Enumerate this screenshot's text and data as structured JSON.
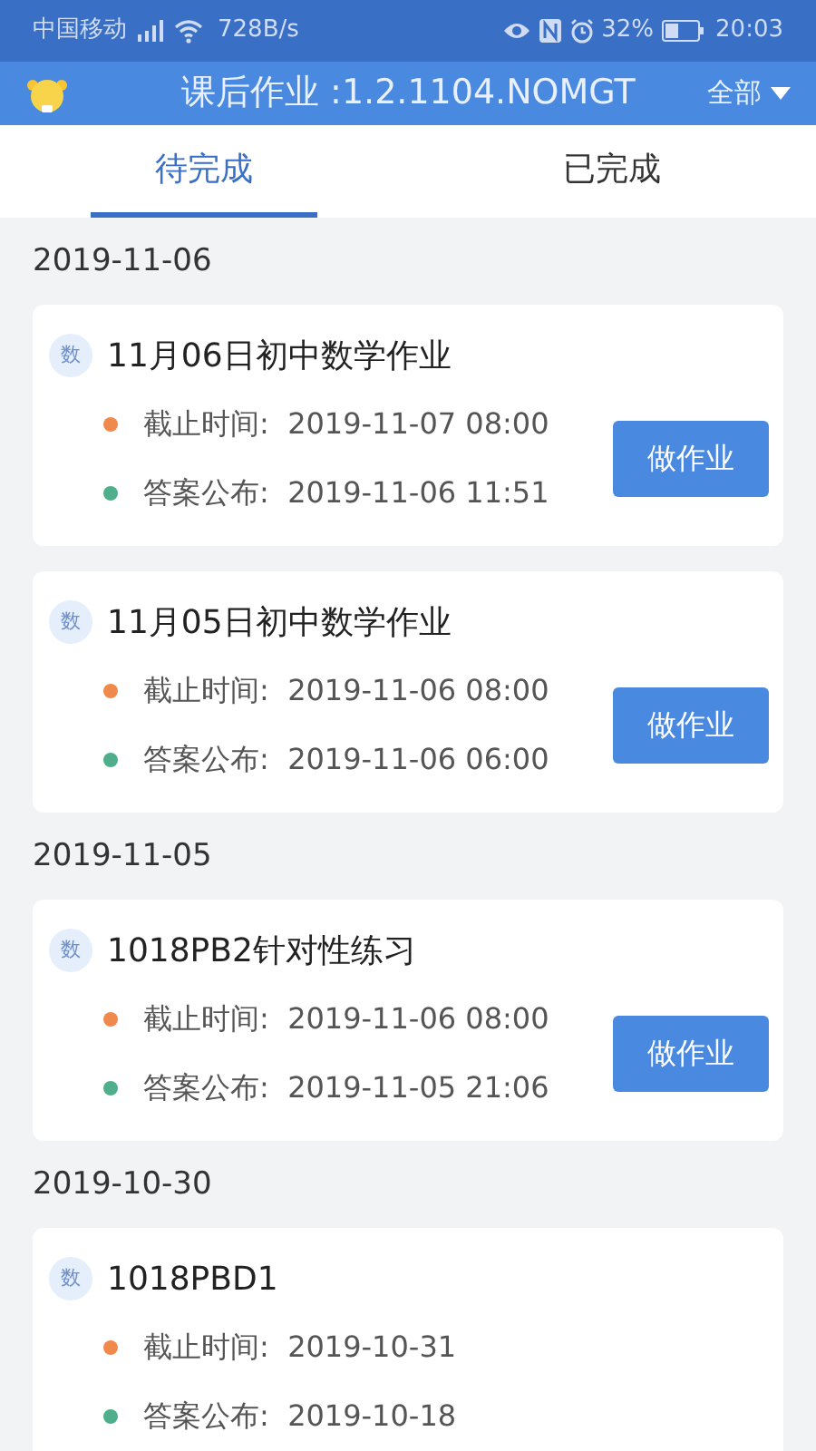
{
  "status_bar": {
    "carrier": "中国移动",
    "speed": "728B/s",
    "battery": "32%",
    "time": "20:03"
  },
  "header": {
    "title": "课后作业 :1.2.1104.NOMGT",
    "filter": "全部"
  },
  "tabs": [
    {
      "label": "待完成",
      "selected": true
    },
    {
      "label": "已完成",
      "selected": false
    }
  ],
  "groups": [
    {
      "date": "2019-11-06",
      "items": [
        {
          "subject": "数",
          "title": "11月06日初中数学作业",
          "deadline": "截止时间:  2019-11-07 08:00",
          "answer": "答案公布:  2019-11-06 11:51",
          "button": "做作业"
        },
        {
          "subject": "数",
          "title": "11月05日初中数学作业",
          "deadline": "截止时间:  2019-11-06 08:00",
          "answer": "答案公布:  2019-11-06 06:00",
          "button": "做作业"
        }
      ]
    },
    {
      "date": "2019-11-05",
      "items": [
        {
          "subject": "数",
          "title": "1018PB2针对性练习",
          "deadline": "截止时间:  2019-11-06 08:00",
          "answer": "答案公布:  2019-11-05 21:06",
          "button": "做作业"
        }
      ]
    },
    {
      "date": "2019-10-30",
      "items": [
        {
          "subject": "数",
          "title": "1018PBD1",
          "deadline": "截止时间:  2019-10-31",
          "answer": "答案公布:  2019-10-18"
        }
      ]
    }
  ]
}
